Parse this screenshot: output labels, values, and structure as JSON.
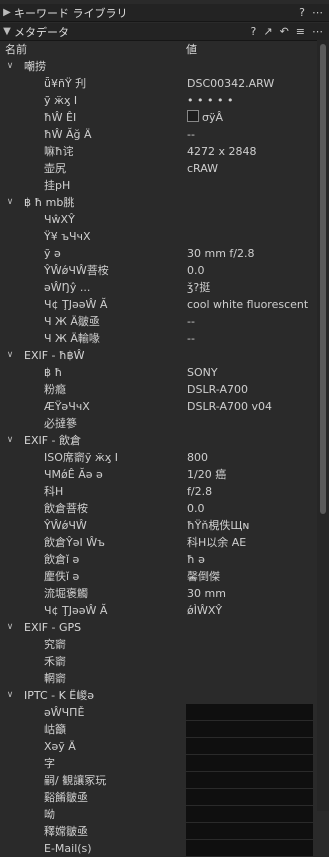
{
  "panels": {
    "keywords": {
      "title": "キーワード ライブラリ",
      "help": "?",
      "menu": "⋯"
    },
    "metadata": {
      "title": "メタデータ",
      "help": "?",
      "popout": "↗",
      "reset": "↶",
      "list": "≡",
      "menu": "⋯"
    }
  },
  "columns": {
    "name": "名前",
    "value": "値"
  },
  "rows": [
    {
      "type": "group",
      "label": "嘲捞",
      "expanded": true
    },
    {
      "type": "field",
      "label": "ǖ¥ñŸ 刋",
      "value": "DSC00342.ARW"
    },
    {
      "type": "field",
      "label": "ỹ  ӝӽ  Ι",
      "value": "• • • • •"
    },
    {
      "type": "field",
      "label": "ħŴ  ÊΙ",
      "value": "σÿÂ",
      "checkbox": true
    },
    {
      "type": "field",
      "label": "ħŴ  Ăğ  Ä",
      "value": "--"
    },
    {
      "type": "field",
      "label": "嘛ħ诧",
      "value": "4272 x 2848"
    },
    {
      "type": "field",
      "label": "壶尻",
      "value": "cRAW"
    },
    {
      "type": "field",
      "label": "挂pH",
      "value": ""
    },
    {
      "type": "group",
      "label": "฿  ħ    mb朓",
      "expanded": true
    },
    {
      "type": "field",
      "label": "ЧŵΧŶ",
      "value": ""
    },
    {
      "type": "field",
      "label": "Ÿ¥  ъЧчΧ",
      "value": ""
    },
    {
      "type": "field",
      "label": "ỹ  ǝ",
      "value": "30 mm f/2.8"
    },
    {
      "type": "field",
      "label": "ŶŴǿЧŴ菩桉",
      "value": "0.0"
    },
    {
      "type": "field",
      "label": "ǝŴŊŷ ...",
      "value": "ǯ?挺"
    },
    {
      "type": "field",
      "label": "Ч¢ ŢЈǝǝŴ  Ă",
      "value": "cool white fluorescent"
    },
    {
      "type": "field",
      "label": "Ч  Ж  Ä皺亟",
      "value": "--"
    },
    {
      "type": "field",
      "label": "Ч  Ж  Ä輸喙",
      "value": "--"
    },
    {
      "type": "group",
      "label": "EXIF - ħ฿Ŵ",
      "expanded": true
    },
    {
      "type": "field",
      "label": "฿  ħ",
      "value": "SONY"
    },
    {
      "type": "field",
      "label": "粉瘾",
      "value": "DSLR-A700"
    },
    {
      "type": "field",
      "label": "ÆŸǝЧчΧ",
      "value": "DSLR-A700 v04"
    },
    {
      "type": "field",
      "label": "必撻篸",
      "value": ""
    },
    {
      "type": "group",
      "label": "EXIF - 飲倉",
      "expanded": true
    },
    {
      "type": "field",
      "label": "ISO席窬ỹ  ӝӽ  Ι",
      "value": "800"
    },
    {
      "type": "field",
      "label": "ЧMǿÊ  Ăǝ  ǝ",
      "value": "1/20 癌"
    },
    {
      "type": "field",
      "label": "科H",
      "value": "f/2.8"
    },
    {
      "type": "field",
      "label": "飲倉菩桉",
      "value": "0.0"
    },
    {
      "type": "field",
      "label": "ŶŴǿЧŴ",
      "value": "ħŸň梘佚Щɴ"
    },
    {
      "type": "field",
      "label": "飲倉ŶǝΙ Ŵъ",
      "value": "科H以余 AE"
    },
    {
      "type": "field",
      "label": "飲倉ǐ  ǝ",
      "value": "ħ  ǝ"
    },
    {
      "type": "field",
      "label": "麈佚ǐ  ǝ",
      "value": "馨倒傑"
    },
    {
      "type": "field",
      "label": "流堀褒觸",
      "value": "30 mm"
    },
    {
      "type": "field",
      "label": "Ч¢ ŢЈǝǝŴ  Ă",
      "value": "ǿÌŴΧŶ"
    },
    {
      "type": "group",
      "label": "EXIF - GPS",
      "expanded": true
    },
    {
      "type": "field",
      "label": "究窬",
      "value": ""
    },
    {
      "type": "field",
      "label": "禾窬",
      "value": ""
    },
    {
      "type": "field",
      "label": "輞窬",
      "value": ""
    },
    {
      "type": "group",
      "label": "IPTC - Κ  Ë嵕ǝ",
      "expanded": true
    },
    {
      "type": "field",
      "label": "ǝŴЧΠĚ",
      "value": "",
      "editable": true
    },
    {
      "type": "field",
      "label": "岵籲",
      "value": "",
      "editable": true
    },
    {
      "type": "field",
      "label": "Χǝỹ Ä",
      "value": "",
      "editable": true
    },
    {
      "type": "field",
      "label": "字",
      "value": "",
      "editable": true
    },
    {
      "type": "field",
      "label": "嗣/ 観讓冢玩",
      "value": "",
      "editable": true
    },
    {
      "type": "field",
      "label": "谿餚皺亟",
      "value": "",
      "editable": true
    },
    {
      "type": "field",
      "label": "呦",
      "value": "",
      "editable": true
    },
    {
      "type": "field",
      "label": "釋嫦皺亟",
      "value": "",
      "editable": true
    },
    {
      "type": "field",
      "label": "E-Mail(s)",
      "value": "",
      "editable": true
    }
  ]
}
